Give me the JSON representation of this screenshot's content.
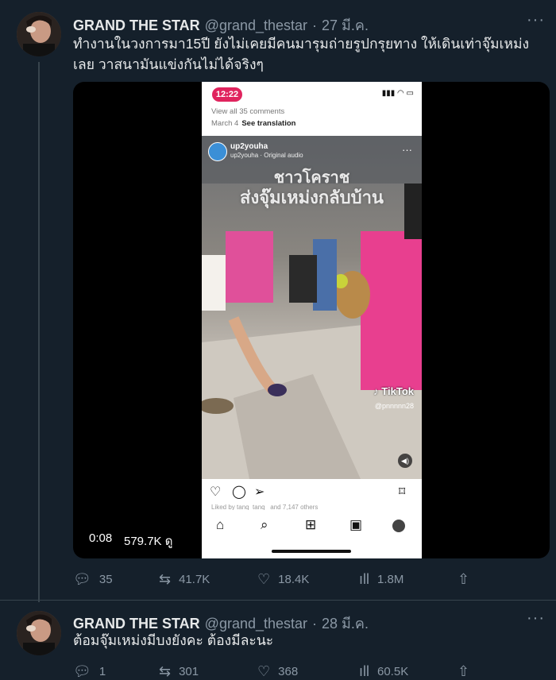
{
  "tweet1": {
    "name": "GRAND THE STAR",
    "handle": "@grand_thestar",
    "dot": "·",
    "date": "27 มี.ค.",
    "text": "ทำงานในวงการมา15ปี ยังไม่เคยมีคนมารุมถ่ายรูปกรุยทาง ให้เดินเท่าจุ๊มเหม่งเลย วาสนามันแข่งกันไม่ได้จริงๆ",
    "media": {
      "time": "0:08",
      "views": "579.7K ดู",
      "phone_time": "12:22",
      "ig_comments": "View all 35 comments",
      "ig_date": "March 4",
      "ig_translate": "See translation",
      "video_user": "up2youha",
      "video_sub": "up2youha · Original audio",
      "video_title1": "ชาวโคราช",
      "video_title2": "ส่งจุ๊มเหม่งกลับบ้าน",
      "tiktok": "TikTok",
      "tiktok_user": "@pnnnnn28",
      "ig_likes": "Liked by tanq_tanq_ and 7,147 others"
    },
    "actions": {
      "replies": "35",
      "retweets": "41.7K",
      "likes": "18.4K",
      "views": "1.8M"
    }
  },
  "tweet2": {
    "name": "GRAND THE STAR",
    "handle": "@grand_thestar",
    "dot": "·",
    "date": "28 มี.ค.",
    "text": "ต้อมจุ๊มเหม่งมีบงยังคะ ต้องมีละนะ",
    "actions": {
      "replies": "1",
      "retweets": "301",
      "likes": "368",
      "views": "60.5K"
    }
  },
  "icons": {
    "reply": "reply-icon",
    "retweet": "retweet-icon",
    "like": "heart-icon",
    "views": "bar-chart-icon",
    "share": "share-icon",
    "more": "more-icon"
  },
  "colors": {
    "background": "#15202b",
    "text": "#e7e9ea",
    "secondary": "#8b98a5",
    "accent": "#e0245e"
  }
}
